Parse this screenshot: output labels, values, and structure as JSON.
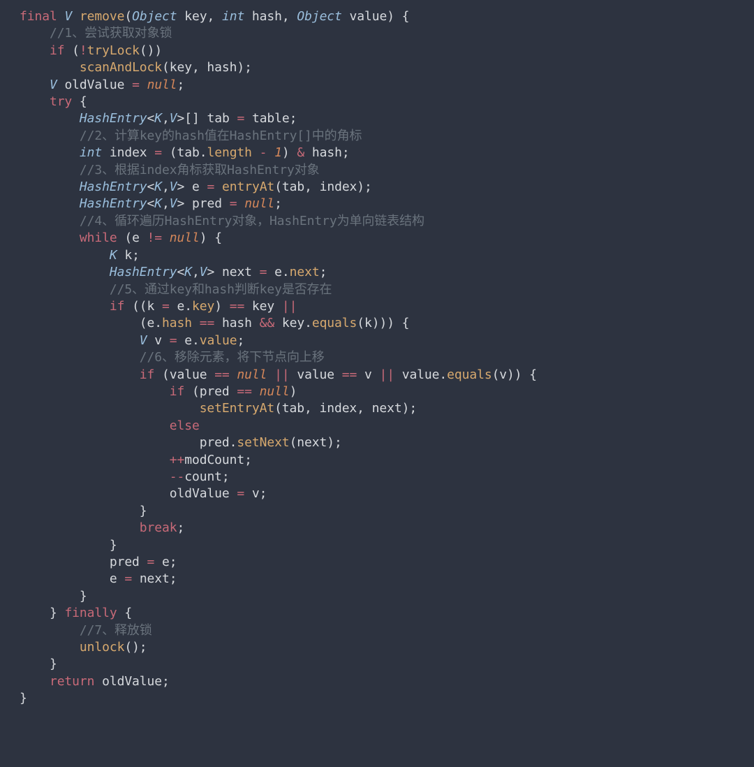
{
  "lines": {
    "l0": {
      "final": "final",
      "V": "V",
      "remove": "remove",
      "lp": "(",
      "Object1": "Object",
      "key": " key",
      "c1": ", ",
      "int": "int",
      "hash": " hash",
      "c2": ", ",
      "Object2": "Object",
      "value": " value",
      "rp": ") {"
    },
    "l1": {
      "cm": "//1、尝试获取对象锁"
    },
    "l2": {
      "if": "if",
      "sp": " (",
      "not": "!",
      "fn": "tryLock",
      "end": "())"
    },
    "l3": {
      "fn": "scanAndLock",
      "args": "(key, hash);"
    },
    "l4": {
      "V": "V",
      "id": " oldValue ",
      "eq": "=",
      "sp": " ",
      "nul": "null",
      "end": ";"
    },
    "l5": {
      "try": "try",
      "sp": " {"
    },
    "l6": {
      "ty": "HashEntry",
      "lt": "<",
      "K": "K",
      "cm": ",",
      "Vv": "V",
      "gt": ">",
      "arr": "[] tab ",
      "eq": "=",
      "end": " table;"
    },
    "l7": {
      "cm": "//2、计算key的hash值在HashEntry[]中的角标"
    },
    "l8": {
      "int": "int",
      "id": " index ",
      "eq": "=",
      "sp": " (tab",
      "dot": ".",
      "len": "length",
      "sp2": " ",
      "minus": "-",
      "sp3": " ",
      "one": "1",
      "rest": ") ",
      "amp": "&",
      "end": " hash;"
    },
    "l9": {
      "cm": "//3、根据index角标获取HashEntry对象"
    },
    "l10": {
      "ty": "HashEntry",
      "lt": "<",
      "K": "K",
      "cm2": ",",
      "Vv": "V",
      "gt": ">",
      "id": " e ",
      "eq": "=",
      "sp": " ",
      "fn": "entryAt",
      "args": "(tab, index);"
    },
    "l11": {
      "ty": "HashEntry",
      "lt": "<",
      "K": "K",
      "cm2": ",",
      "Vv": "V",
      "gt": ">",
      "id": " pred ",
      "eq": "=",
      "sp": " ",
      "nul": "null",
      "end": ";"
    },
    "l12": {
      "cm": "//4、循环遍历HashEntry对象，HashEntry为单向链表结构"
    },
    "l13": {
      "while": "while",
      "sp": " (e ",
      "ne": "!=",
      "sp2": " ",
      "nul": "null",
      "end": ") {"
    },
    "l14": {
      "K": "K",
      "id": " k;"
    },
    "l15": {
      "ty": "HashEntry",
      "lt": "<",
      "K": "K",
      "cm2": ",",
      "Vv": "V",
      "gt": ">",
      "id": " next ",
      "eq": "=",
      "sp": " e",
      "dot": ".",
      "next": "next",
      ";": ";"
    },
    "l16": {
      "cm": "//5、通过key和hash判断key是否存在"
    },
    "l17": {
      "if": "if",
      "sp": " ((k ",
      "eq": "=",
      "sp2": " e",
      "dot": ".",
      "key": "key",
      ") ": ") ",
      "ee": "==",
      "sp3": " key ",
      "or": "||"
    },
    "l18": {
      "sp": "(e",
      "dot": ".",
      "hash": "hash",
      "sp2": " ",
      "ee": "==",
      "sp3": " hash ",
      "and": "&&",
      "sp4": " key",
      "dot2": ".",
      "fn": "equals",
      "args": "(k))) {"
    },
    "l19": {
      "V": "V",
      "id": " v ",
      "eq": "=",
      "sp": " e",
      "dot": ".",
      "value": "value",
      ";": ";"
    },
    "l20": {
      "cm": "//6、移除元素，将下节点向上移"
    },
    "l21": {
      "if": "if",
      "sp": " (value ",
      "ee": "==",
      "sp2": " ",
      "nul": "null",
      "sp3": " ",
      "or": "||",
      "sp4": " value ",
      "ee2": "==",
      "sp5": " v ",
      "or2": "||",
      "sp6": " value",
      "dot": ".",
      "fn": "equals",
      "args": "(v)) {"
    },
    "l22": {
      "if": "if",
      "sp": " (pred ",
      "ee": "==",
      "sp2": " ",
      "nul": "null",
      "end": ")"
    },
    "l23": {
      "fn": "setEntryAt",
      "args": "(tab, index, next);"
    },
    "l24": {
      "else": "else"
    },
    "l25": {
      "pred": "pred",
      "dot": ".",
      "fn": "setNext",
      "args": "(next);"
    },
    "l26": {
      "inc": "++",
      "id": "modCount;"
    },
    "l27": {
      "dec": "--",
      "id": "count;"
    },
    "l28": {
      "id": "oldValue ",
      "eq": "=",
      "end": " v;"
    },
    "l29": {
      "br": "}"
    },
    "l30": {
      "break": "break",
      "end": ";"
    },
    "l31": {
      "br": "}"
    },
    "l32": {
      "id": "pred ",
      "eq": "=",
      "end": " e;"
    },
    "l33": {
      "id": "e ",
      "eq": "=",
      "end": " next;"
    },
    "l34": {
      "br": "}"
    },
    "l35": {
      "br": "} ",
      "finally": "finally",
      "end": " {"
    },
    "l36": {
      "cm": "//7、释放锁"
    },
    "l37": {
      "fn": "unlock",
      "args": "();"
    },
    "l38": {
      "br": "}"
    },
    "l39": {
      "return": "return",
      "id": " oldValue;"
    },
    "l40": {
      "br": "}"
    }
  }
}
